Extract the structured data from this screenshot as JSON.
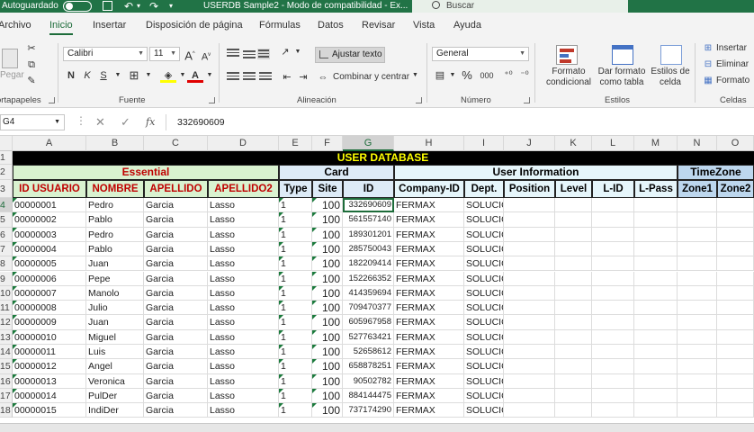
{
  "titlebar": {
    "autosave_label": "Autoguardado",
    "doc_title": "USERDB Sample2 - Modo de compatibilidad - Ex...",
    "search_placeholder": "Buscar",
    "accent_color": "#217346"
  },
  "tabs": [
    "Archivo",
    "Inicio",
    "Insertar",
    "Disposición de página",
    "Fórmulas",
    "Datos",
    "Revisar",
    "Vista",
    "Ayuda"
  ],
  "active_tab": "Inicio",
  "ribbon": {
    "clipboard": {
      "paste_label": "Pegar",
      "group_label": "ortapapeles"
    },
    "font": {
      "family": "Calibri",
      "size": "11",
      "bold": "N",
      "italic": "K",
      "underline": "S",
      "group_label": "Fuente"
    },
    "alignment": {
      "wrap_label": "Ajustar texto",
      "merge_label": "Combinar y centrar",
      "group_label": "Alineación"
    },
    "number": {
      "format": "General",
      "percent": "%",
      "thousands": "000",
      "group_label": "Número"
    },
    "styles": {
      "conditional_label": "Formato condicional",
      "table_label": "Dar formato como tabla",
      "cell_styles_label": "Estilos de celda",
      "group_label": "Estilos"
    },
    "cells": {
      "insert_label": "Insertar",
      "delete_label": "Eliminar",
      "format_label": "Formato",
      "group_label": "Celdas"
    }
  },
  "formula_bar": {
    "name_box": "G4",
    "fx": "fx",
    "formula": "332690609"
  },
  "columns": [
    "A",
    "B",
    "C",
    "D",
    "E",
    "F",
    "G",
    "H",
    "I",
    "J",
    "K",
    "L",
    "M",
    "N",
    "O"
  ],
  "row_numbers": [
    "1",
    "2",
    "3",
    "4",
    "5",
    "6",
    "7",
    "8",
    "9",
    "10",
    "11",
    "12",
    "13",
    "14",
    "15",
    "16",
    "17",
    "18"
  ],
  "banner": "USER DATABASE",
  "sections": {
    "essential": "Essential",
    "card": "Card",
    "user_info": "User Information",
    "timezone": "TimeZone"
  },
  "section_colors": {
    "essential_bg": "#d9f2d0",
    "essential_text": "#c00000",
    "card_bg": "#ddebf7",
    "userinfo_bg": "#e6f6fb",
    "timezone_bg": "#bdd7ee"
  },
  "headers": [
    "ID USUARIO",
    "NOMBRE",
    "APELLIDO",
    "APELLIDO2",
    "Type",
    "Site",
    "ID",
    "Company-ID",
    "Dept.",
    "Position",
    "Level",
    "L-ID",
    "L-Pass",
    "Zone1",
    "Zone2"
  ],
  "rows": [
    [
      "00000001",
      "Pedro",
      "Garcia",
      "Lasso",
      "1",
      "100",
      "332690609",
      "FERMAX",
      "SOLUCIONES"
    ],
    [
      "00000002",
      "Pablo",
      "Garcia",
      "Lasso",
      "1",
      "100",
      "561557140",
      "FERMAX",
      "SOLUCIONES"
    ],
    [
      "00000003",
      "Pedro",
      "Garcia",
      "Lasso",
      "1",
      "100",
      "189301201",
      "FERMAX",
      "SOLUCIONES"
    ],
    [
      "00000004",
      "Pablo",
      "Garcia",
      "Lasso",
      "1",
      "100",
      "285750043",
      "FERMAX",
      "SOLUCIONES"
    ],
    [
      "00000005",
      "Juan",
      "Garcia",
      "Lasso",
      "1",
      "100",
      "182209414",
      "FERMAX",
      "SOLUCIONES"
    ],
    [
      "00000006",
      "Pepe",
      "Garcia",
      "Lasso",
      "1",
      "100",
      "152266352",
      "FERMAX",
      "SOLUCIONES"
    ],
    [
      "00000007",
      "Manolo",
      "Garcia",
      "Lasso",
      "1",
      "100",
      "414359694",
      "FERMAX",
      "SOLUCIONES"
    ],
    [
      "00000008",
      "Julio",
      "Garcia",
      "Lasso",
      "1",
      "100",
      "709470377",
      "FERMAX",
      "SOLUCIONES"
    ],
    [
      "00000009",
      "Juan",
      "Garcia",
      "Lasso",
      "1",
      "100",
      "605967958",
      "FERMAX",
      "SOLUCIONES"
    ],
    [
      "00000010",
      "Miguel",
      "Garcia",
      "Lasso",
      "1",
      "100",
      "527763421",
      "FERMAX",
      "SOLUCIONES"
    ],
    [
      "00000011",
      "Luis",
      "Garcia",
      "Lasso",
      "1",
      "100",
      "52658612",
      "FERMAX",
      "SOLUCIONES"
    ],
    [
      "00000012",
      "Angel",
      "Garcia",
      "Lasso",
      "1",
      "100",
      "658878251",
      "FERMAX",
      "SOLUCIONES"
    ],
    [
      "00000013",
      "Veronica",
      "Garcia",
      "Lasso",
      "1",
      "100",
      "90502782",
      "FERMAX",
      "SOLUCIONES"
    ],
    [
      "00000014",
      "PulDer",
      "Garcia",
      "Lasso",
      "1",
      "100",
      "884144475",
      "FERMAX",
      "SOLUCIONES"
    ],
    [
      "00000015",
      "IndiDer",
      "Garcia",
      "Lasso",
      "1",
      "100",
      "737174290",
      "FERMAX",
      "SOLUCIONES"
    ]
  ]
}
